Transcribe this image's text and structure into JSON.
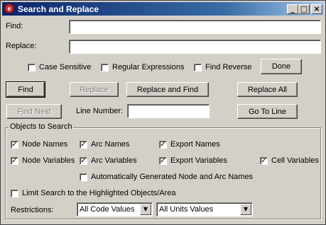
{
  "window": {
    "title": "Search and Replace",
    "minimize": "_",
    "maximize": "□",
    "close": "×"
  },
  "find": {
    "label": "Find:",
    "value": ""
  },
  "replace": {
    "label": "Replace:",
    "value": ""
  },
  "options": {
    "case_sensitive": {
      "label": "Case Sensitive",
      "checked": false
    },
    "regular_expressions": {
      "label": "Regular Expressions",
      "checked": false
    },
    "find_reverse": {
      "label": "Find Reverse",
      "checked": false
    }
  },
  "buttons": {
    "done": "Done",
    "find": "Find",
    "replace": "Replace",
    "replace_and_find": "Replace and Find",
    "replace_all": "Replace All",
    "find_next": "Find Next",
    "go_to_line": "Go To Line"
  },
  "line_number": {
    "label": "Line Number:",
    "value": ""
  },
  "objects": {
    "title": "Objects to Search",
    "node_names": {
      "label": "Node Names",
      "checked": true
    },
    "arc_names": {
      "label": "Arc Names",
      "checked": true
    },
    "export_names": {
      "label": "Export Names",
      "checked": true
    },
    "node_variables": {
      "label": "Node Variables",
      "checked": true
    },
    "arc_variables": {
      "label": "Arc Variables",
      "checked": true
    },
    "export_variables": {
      "label": "Export Variables",
      "checked": true
    },
    "cell_variables": {
      "label": "Cell Variables",
      "checked": true
    },
    "auto_generated": {
      "label": "Automatically Generated Node and Arc Names",
      "checked": false
    },
    "limit_search": {
      "label": "Limit Search to the Highlighted Objects/Area",
      "checked": false
    },
    "restrictions_label": "Restrictions:",
    "code_values": "All Code Values",
    "units_values": "All Units Values"
  },
  "check_glyph": "✓",
  "dropdown_glyph": "▼"
}
